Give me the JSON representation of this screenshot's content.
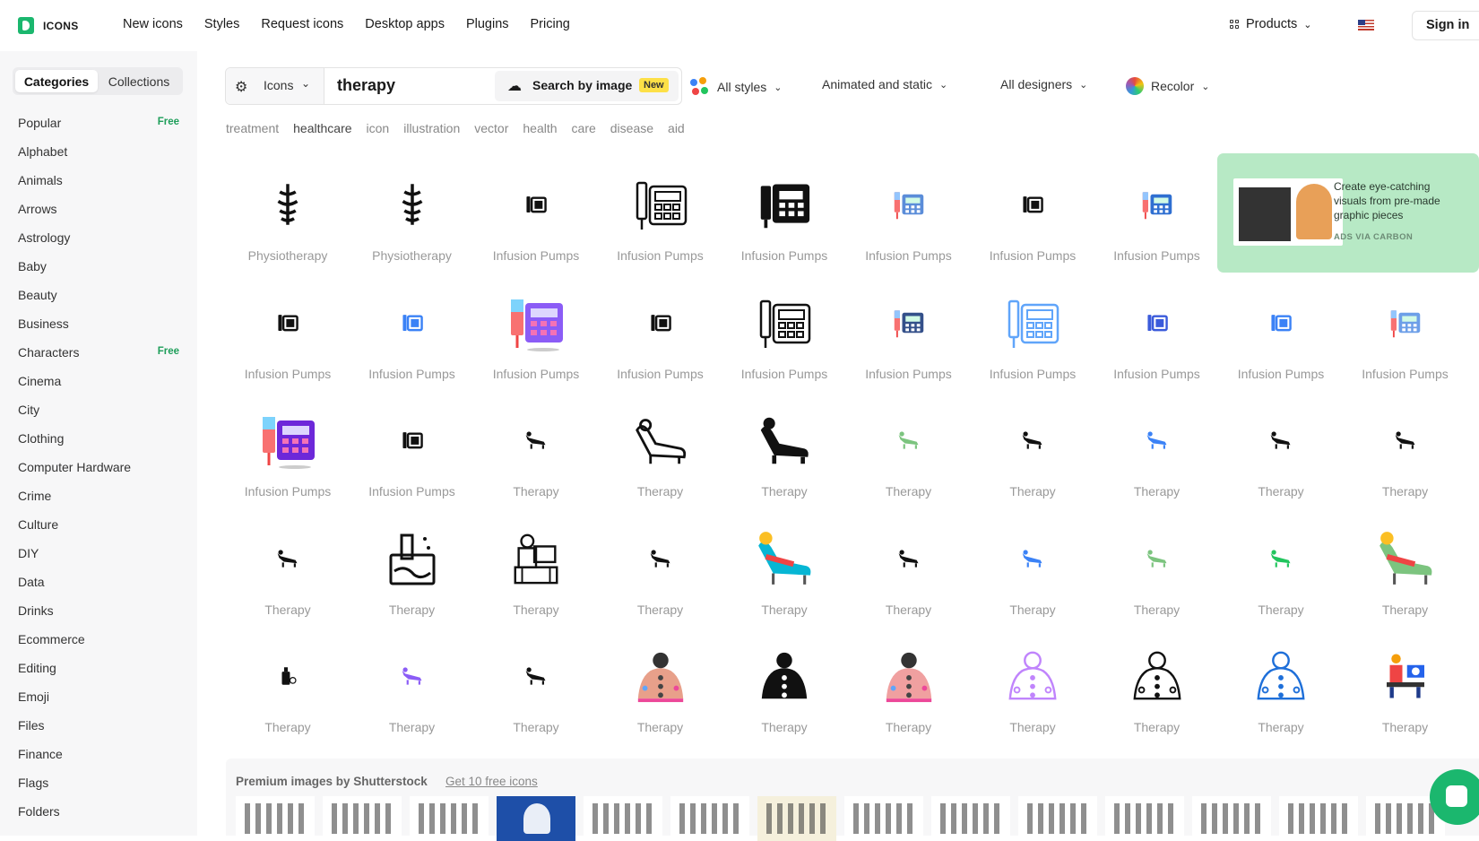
{
  "brand": {
    "name": "ICONS"
  },
  "nav": {
    "links": [
      "New icons",
      "Styles",
      "Request icons",
      "Desktop apps",
      "Plugins",
      "Pricing"
    ],
    "products": "Products",
    "sign_in": "Sign in"
  },
  "sidebar": {
    "tabs": [
      "Categories",
      "Collections"
    ],
    "categories": [
      {
        "label": "Popular",
        "badge": "Free"
      },
      {
        "label": "Alphabet"
      },
      {
        "label": "Animals"
      },
      {
        "label": "Arrows"
      },
      {
        "label": "Astrology"
      },
      {
        "label": "Baby"
      },
      {
        "label": "Beauty"
      },
      {
        "label": "Business"
      },
      {
        "label": "Characters",
        "badge": "Free"
      },
      {
        "label": "Cinema"
      },
      {
        "label": "City"
      },
      {
        "label": "Clothing"
      },
      {
        "label": "Computer Hardware"
      },
      {
        "label": "Crime"
      },
      {
        "label": "Culture"
      },
      {
        "label": "DIY"
      },
      {
        "label": "Data"
      },
      {
        "label": "Drinks"
      },
      {
        "label": "Ecommerce"
      },
      {
        "label": "Editing"
      },
      {
        "label": "Emoji"
      },
      {
        "label": "Files"
      },
      {
        "label": "Finance"
      },
      {
        "label": "Flags"
      },
      {
        "label": "Folders"
      }
    ]
  },
  "search": {
    "type": "Icons",
    "query": "therapy",
    "by_image": "Search by image",
    "new_badge": "New"
  },
  "filters": {
    "styles": "All styles",
    "animation": "Animated and static",
    "designers": "All designers",
    "recolor": "Recolor"
  },
  "tags": [
    "treatment",
    "healthcare",
    "icon",
    "illustration",
    "vector",
    "health",
    "care",
    "disease",
    "aid"
  ],
  "ad": {
    "text": "Create eye-catching visuals from pre-made graphic pieces",
    "via": "ADS VIA CARBON"
  },
  "icons": [
    {
      "label": "Physiotherapy",
      "kind": "caduceus",
      "color": "#111111"
    },
    {
      "label": "Physiotherapy",
      "kind": "caduceus",
      "color": "#111111"
    },
    {
      "label": "Infusion Pumps",
      "kind": "pump-small",
      "color": "#111111"
    },
    {
      "label": "Infusion Pumps",
      "kind": "pump-outline",
      "color": "#111111"
    },
    {
      "label": "Infusion Pumps",
      "kind": "pump-solid",
      "color": "#111111"
    },
    {
      "label": "Infusion Pumps",
      "kind": "pump-color",
      "color": "#5b8dd9"
    },
    {
      "label": "Infusion Pumps",
      "kind": "pump-small",
      "color": "#111111"
    },
    {
      "label": "Infusion Pumps",
      "kind": "pump-color",
      "color": "#2f6fd1"
    },
    {
      "label": "Infusion Pumps",
      "kind": "pump-small",
      "color": "#111111"
    },
    {
      "label": "Infusion Pumps",
      "kind": "pump-small",
      "color": "#3b82f6"
    },
    {
      "label": "Infusion Pumps",
      "kind": "pump-purple",
      "color": "#8b5cf6"
    },
    {
      "label": "Infusion Pumps",
      "kind": "pump-small",
      "color": "#111111"
    },
    {
      "label": "Infusion Pumps",
      "kind": "pump-outline",
      "color": "#111111"
    },
    {
      "label": "Infusion Pumps",
      "kind": "pump-color",
      "color": "#34508a"
    },
    {
      "label": "Infusion Pumps",
      "kind": "pump-outline",
      "color": "#60a5fa"
    },
    {
      "label": "Infusion Pumps",
      "kind": "pump-small",
      "color": "#3b5bdb"
    },
    {
      "label": "Infusion Pumps",
      "kind": "pump-small",
      "color": "#3b82f6"
    },
    {
      "label": "Infusion Pumps",
      "kind": "pump-color",
      "color": "#6d9fe8"
    },
    {
      "label": "Infusion Pumps",
      "kind": "pump-purple",
      "color": "#6d28d9"
    },
    {
      "label": "Infusion Pumps",
      "kind": "pump-small",
      "color": "#111111"
    },
    {
      "label": "Therapy",
      "kind": "couch-small",
      "color": "#111111"
    },
    {
      "label": "Therapy",
      "kind": "couch-outline",
      "color": "#111111"
    },
    {
      "label": "Therapy",
      "kind": "couch-solid",
      "color": "#111111"
    },
    {
      "label": "Therapy",
      "kind": "couch-small",
      "color": "#7cc47f"
    },
    {
      "label": "Therapy",
      "kind": "couch-small",
      "color": "#111111"
    },
    {
      "label": "Therapy",
      "kind": "couch-small",
      "color": "#3b82f6"
    },
    {
      "label": "Therapy",
      "kind": "couch-small",
      "color": "#111111"
    },
    {
      "label": "Therapy",
      "kind": "couch-small",
      "color": "#111111"
    },
    {
      "label": "Therapy",
      "kind": "couch-small",
      "color": "#111111"
    },
    {
      "label": "Therapy",
      "kind": "bath",
      "color": "#111111"
    },
    {
      "label": "Therapy",
      "kind": "therapist",
      "color": "#111111"
    },
    {
      "label": "Therapy",
      "kind": "couch-small",
      "color": "#111111"
    },
    {
      "label": "Therapy",
      "kind": "couch-color",
      "color": "#06b6d4"
    },
    {
      "label": "Therapy",
      "kind": "couch-small",
      "color": "#111111"
    },
    {
      "label": "Therapy",
      "kind": "couch-small",
      "color": "#3b82f6"
    },
    {
      "label": "Therapy",
      "kind": "couch-small",
      "color": "#7cc47f"
    },
    {
      "label": "Therapy",
      "kind": "couch-small",
      "color": "#22c55e"
    },
    {
      "label": "Therapy",
      "kind": "couch-color",
      "color": "#7cc47f"
    },
    {
      "label": "Therapy",
      "kind": "bottle",
      "color": "#111111"
    },
    {
      "label": "Therapy",
      "kind": "couch-small",
      "color": "#8b5cf6"
    },
    {
      "label": "Therapy",
      "kind": "couch-small",
      "color": "#111111"
    },
    {
      "label": "Therapy",
      "kind": "back",
      "color": "#e8a08a"
    },
    {
      "label": "Therapy",
      "kind": "back-solid",
      "color": "#111111"
    },
    {
      "label": "Therapy",
      "kind": "back",
      "color": "#f0a0a0"
    },
    {
      "label": "Therapy",
      "kind": "back-outline",
      "color": "#c084fc"
    },
    {
      "label": "Therapy",
      "kind": "back-outline",
      "color": "#111111"
    },
    {
      "label": "Therapy",
      "kind": "back-outline",
      "color": "#1e6fd9"
    },
    {
      "label": "Therapy",
      "kind": "person-desk",
      "color": "#2563eb"
    }
  ],
  "premium": {
    "title": "Premium images by Shutterstock",
    "link": "Get 10 free icons"
  }
}
